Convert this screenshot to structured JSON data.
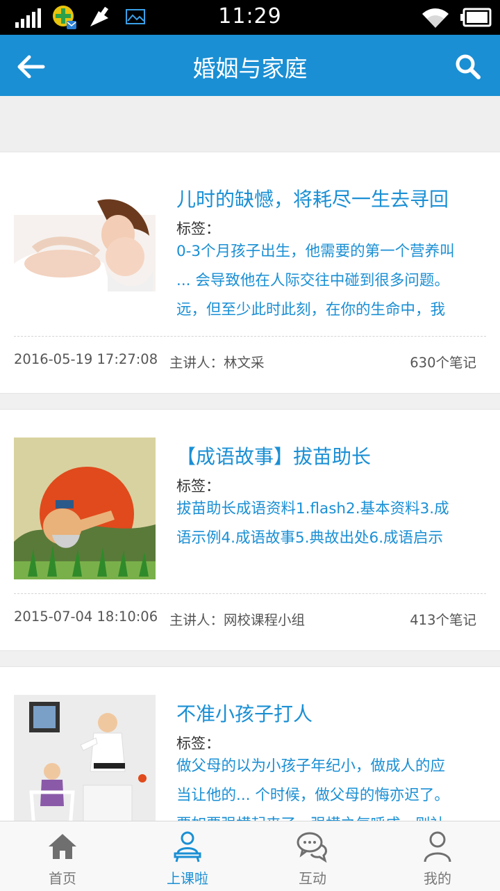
{
  "status_bar": {
    "time": "11:29",
    "icons": [
      "signal-icon",
      "app-notification-icon",
      "broom-icon",
      "image-icon",
      "wifi-icon",
      "battery-icon"
    ]
  },
  "header": {
    "title": "婚姻与家庭",
    "back_icon": "arrow-left-icon",
    "search_icon": "search-icon"
  },
  "courses": [
    {
      "title": "儿时的缺憾，将耗尽一生去寻回",
      "tag_label": "标签：",
      "desc_lines": [
        "0-3个月孩子出生，他需要的第一个营养叫",
        "... 会导致他在人际交往中碰到很多问题。",
        "远，但至少此时此刻，在你的生命中，我"
      ],
      "date": "2016-05-19 17:27:08",
      "lecturer": "主讲人：林文采",
      "notes": "630个笔记"
    },
    {
      "title": "【成语故事】拔苗助长",
      "tag_label": "标签：",
      "desc_lines": [
        "拔苗助长成语资料1.flash2.基本资料3.成",
        "语示例4.成语故事5.典故出处6.成语启示"
      ],
      "date": "2015-07-04 18:10:06",
      "lecturer": "主讲人：网校课程小组",
      "notes": "413个笔记"
    },
    {
      "title": "不准小孩子打人",
      "tag_label": "标签：",
      "desc_lines": [
        "做父母的以为小孩子年纪小，做成人的应",
        "当让他的... 个时候，做父母的悔亦迟了。",
        "要如要强横起来了，强横之气呼成，则社"
      ]
    }
  ],
  "tabbar": {
    "tabs": [
      {
        "label": "首页",
        "icon": "home-icon"
      },
      {
        "label": "上课啦",
        "icon": "person-desk-icon"
      },
      {
        "label": "互动",
        "icon": "chat-bubbles-icon"
      },
      {
        "label": "我的",
        "icon": "user-icon"
      }
    ],
    "active_index": 1
  },
  "colors": {
    "accent": "#1a8fd4",
    "status_bar": "#000000",
    "background": "#f0f0f0"
  }
}
